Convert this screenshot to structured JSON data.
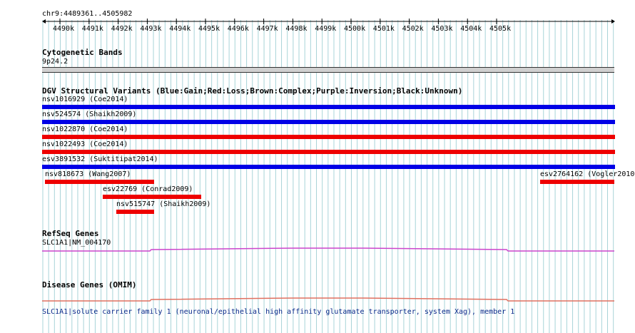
{
  "coordinate": "chr9:4489361..4505982",
  "ruler_ticks": [
    "4490k",
    "4491k",
    "4492k",
    "4493k",
    "4494k",
    "4495k",
    "4496k",
    "4497k",
    "4498k",
    "4499k",
    "4500k",
    "4501k",
    "4502k",
    "4503k",
    "4504k",
    "4505k"
  ],
  "tracks": {
    "cytogenetic": {
      "title": "Cytogenetic Bands",
      "band": "9p24.2"
    },
    "dgv": {
      "title": "DGV Structural Variants (Blue:Gain;Red:Loss;Brown:Complex;Purple:Inversion;Black:Unknown)",
      "variants": [
        {
          "label": "nsv1016929 (Coe2014)",
          "type": "Gain"
        },
        {
          "label": "nsv524574 (Shaikh2009)",
          "type": "Gain"
        },
        {
          "label": "nsv1022870 (Coe2014)",
          "type": "Loss"
        },
        {
          "label": "nsv1022493 (Coe2014)",
          "type": "Loss"
        },
        {
          "label": "esv3891532 (Suktitipat2014)",
          "type": "Gain"
        },
        {
          "label": "nsv818673 (Wang2007)",
          "type": "Loss"
        },
        {
          "label": "esv2764162 (Vogler2010",
          "type": "Loss"
        },
        {
          "label": "esv22769 (Conrad2009)",
          "type": "Loss"
        },
        {
          "label": "nsv515747 (Shaikh2009)",
          "type": "Loss"
        }
      ]
    },
    "refseq": {
      "title": "RefSeq Genes",
      "gene": "SLC1A1|NM_004170"
    },
    "omim": {
      "title": "Disease Genes (OMIM)",
      "entry": "SLC1A1|solute carrier family 1 (neuronal/epithelial high affinity glutamate transporter, system Xag), member 1"
    }
  },
  "colors": {
    "gain": "#0000e6",
    "loss": "#ee0000",
    "grid": "#a8d4d8",
    "refseq": "#cc44cc",
    "omim": "#e07060"
  }
}
